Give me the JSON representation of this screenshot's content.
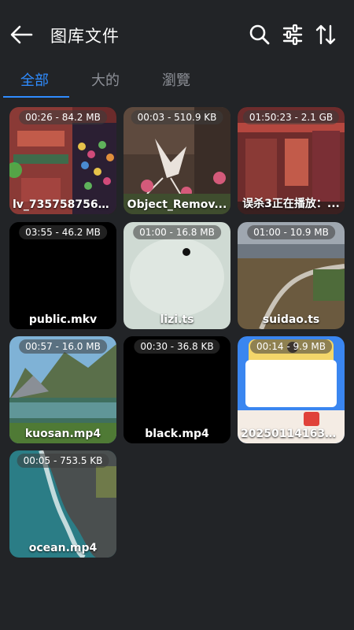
{
  "header": {
    "title": "图库文件"
  },
  "tabs": [
    {
      "label": "全部",
      "active": true
    },
    {
      "label": "大的",
      "active": false
    },
    {
      "label": "瀏覽",
      "active": false
    }
  ],
  "files": [
    {
      "badge": "00:26 - 84.2 MB",
      "name": "lv_7357587564..."
    },
    {
      "badge": "00:03 - 510.9 KB",
      "name": "Object_Remov..."
    },
    {
      "badge": "01:50:23 - 2.1 GB",
      "name": "误杀3正在播放：..."
    },
    {
      "badge": "03:55 - 46.2 MB",
      "name": "public.mkv"
    },
    {
      "badge": "01:00 - 16.8 MB",
      "name": "lizi.ts"
    },
    {
      "badge": "01:00 - 10.9 MB",
      "name": "suidao.ts"
    },
    {
      "badge": "00:57 - 16.0 MB",
      "name": "kuosan.mp4"
    },
    {
      "badge": "00:30 - 36.8 KB",
      "name": "black.mp4"
    },
    {
      "badge": "00:14 - 9.9 MB",
      "name": "20250114163340..."
    },
    {
      "badge": "00:05 - 753.5 KB",
      "name": "ocean.mp4"
    }
  ],
  "colors": {
    "background": "#222427",
    "accent": "#2f8cff",
    "inactive_tab": "#8d9097"
  },
  "icons": [
    "back-arrow-icon",
    "search-icon",
    "filter-sliders-icon",
    "sort-icon"
  ]
}
